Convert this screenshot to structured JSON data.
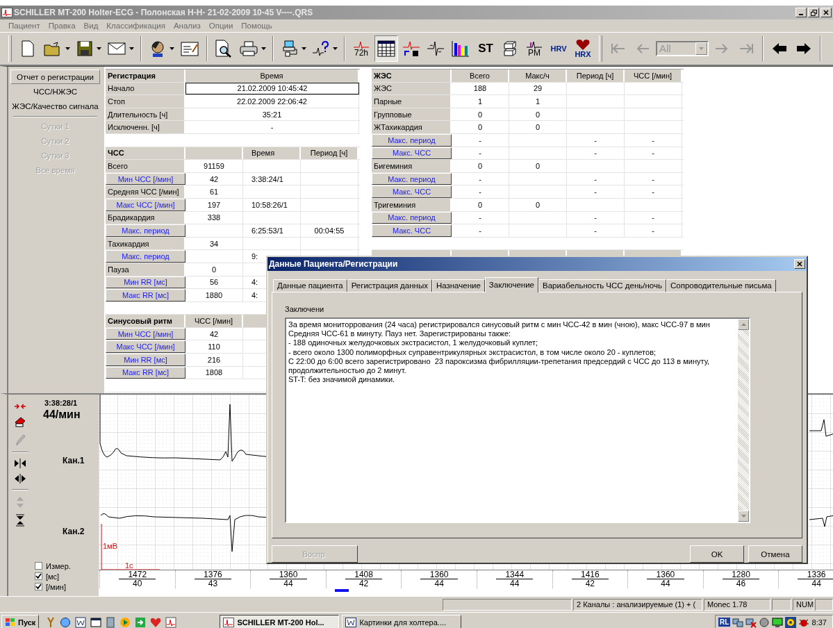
{
  "window": {
    "title": "SCHILLER MT-200 Holter-ECG - Полонская Н-Н- 21-02-2009 10-45 V----.QRS"
  },
  "menu": [
    "Пациент",
    "Правка",
    "Вид",
    "Классификация",
    "Анализ",
    "Опции",
    "Помощь"
  ],
  "toolbar": {
    "hours_label": "72h",
    "st_label": "ST",
    "pm_label": "PM",
    "hrv_label": "HRV",
    "hrx_label": "HRX",
    "table_selected": true,
    "filter": {
      "value": "All",
      "disabled": true
    }
  },
  "nav": [
    {
      "label": "Отчет о регистрации",
      "selected": true,
      "disabled": false
    },
    {
      "label": "ЧСС/НЖЭС",
      "selected": false,
      "disabled": false
    },
    {
      "label": "ЖЭС/Качество сигнала",
      "selected": false,
      "disabled": false
    },
    {
      "label": "Сутки 1",
      "selected": false,
      "disabled": true
    },
    {
      "label": "Сутки 2",
      "selected": false,
      "disabled": true
    },
    {
      "label": "Сутки 3",
      "selected": false,
      "disabled": true
    },
    {
      "label": "Все время",
      "selected": false,
      "disabled": true
    }
  ],
  "hr_table": {
    "rows": [
      {
        "kind": "wide_heading",
        "label": "Регистрация",
        "value": "Время"
      },
      {
        "kind": "wide",
        "label": "Начало",
        "value": "21.02.2009 10:45:42",
        "focused": true
      },
      {
        "kind": "wide",
        "label": "Стоп",
        "value": "22.02.2009 22:06:42",
        "focused": false
      },
      {
        "kind": "wide",
        "label": "Длительность [ч]",
        "value": "35:21",
        "focused": false
      },
      {
        "kind": "wide",
        "label": "Исключенн. [ч]",
        "value": "-",
        "focused": false
      },
      {
        "kind": "blank"
      },
      {
        "kind": "heading",
        "label": "ЧСС",
        "time": "Время",
        "period": "Период [ч]"
      },
      {
        "kind": "row",
        "label": "Всего",
        "value": "91159"
      },
      {
        "kind": "button_row",
        "label": "Мин ЧСС [/мин]",
        "value": "42",
        "time": "3:38:24/1"
      },
      {
        "kind": "row",
        "label": "Средняя ЧСС [/мин]",
        "value": "61"
      },
      {
        "kind": "button_row",
        "label": "Макс ЧСС [/мин]",
        "value": "197",
        "time": "10:58:26/1"
      },
      {
        "kind": "row",
        "label": "Брадикардия",
        "value": "338"
      },
      {
        "kind": "button_row",
        "label": "Макс. период",
        "time": "6:25:53/1",
        "period": "00:04:55"
      },
      {
        "kind": "row",
        "label": "Тахикардия",
        "value": "34"
      },
      {
        "kind": "button_row",
        "label": "Макс. период",
        "time": "9:"
      },
      {
        "kind": "row",
        "label": "Пауза",
        "value": "0"
      },
      {
        "kind": "button_row",
        "label": "Мин RR [мс]",
        "value": "56",
        "time": "4:"
      },
      {
        "kind": "button_row",
        "label": "Макс RR [мс]",
        "value": "1880",
        "time": "4:"
      },
      {
        "kind": "blank"
      },
      {
        "kind": "heading",
        "label": "Синусовый ритм",
        "value": "ЧСС [/мин]"
      },
      {
        "kind": "button_row",
        "label": "Мин ЧСС [/мин]",
        "value": "42"
      },
      {
        "kind": "button_row",
        "label": "Макс ЧСС [/мин]",
        "value": "110"
      },
      {
        "kind": "button_row",
        "label": "Мин RR [мс]",
        "value": "216"
      },
      {
        "kind": "button_row",
        "label": "Макс RR [мс]",
        "value": "1808"
      },
      {
        "kind": "blank"
      }
    ]
  },
  "pvc_table": {
    "rows": [
      {
        "kind": "heading",
        "label": "ЖЭС",
        "total": "Всего",
        "max_per_hour": "Макс/ч",
        "period": "Период [ч]",
        "hr": "ЧСС [/мин]"
      },
      {
        "kind": "row",
        "label": "ЖЭС",
        "total": "188",
        "max_per_hour": "29"
      },
      {
        "kind": "row",
        "label": "Парные",
        "total": "1",
        "max_per_hour": "1"
      },
      {
        "kind": "row",
        "label": "Групповые",
        "total": "0",
        "max_per_hour": "0"
      },
      {
        "kind": "row",
        "label": "ЖТахикардия",
        "total": "0",
        "max_per_hour": "0"
      },
      {
        "kind": "button_row",
        "label": "Макс. период",
        "total": "-",
        "period": "-",
        "hr": "-"
      },
      {
        "kind": "button_row",
        "label": "Макс. ЧСС",
        "total": "-",
        "period": "-",
        "hr": "-"
      },
      {
        "kind": "row",
        "label": "Бигеминия",
        "total": "0",
        "max_per_hour": "0"
      },
      {
        "kind": "button_row",
        "label": "Макс. период",
        "total": "-",
        "period": "-",
        "hr": "-"
      },
      {
        "kind": "button_row",
        "label": "Макс. ЧСС",
        "total": "-",
        "period": "-",
        "hr": "-"
      },
      {
        "kind": "row",
        "label": "Тригеминия",
        "total": "0",
        "max_per_hour": "0"
      },
      {
        "kind": "button_row",
        "label": "Макс. период",
        "total": "-",
        "period": "-",
        "hr": "-"
      },
      {
        "kind": "button_row",
        "label": "Макс. ЧСС",
        "total": "-",
        "period": "-",
        "hr": "-"
      },
      {
        "kind": "blank"
      },
      {
        "kind": "heading"
      }
    ]
  },
  "ecg": {
    "time": "3:38:28/1",
    "rate": "44/мин",
    "channels": [
      "Кан.1",
      "Кан.2"
    ],
    "scale_voltage": "1мВ",
    "scale_time": "1с",
    "options": [
      {
        "label": "Измер.",
        "checked": false
      },
      {
        "label": "[мс]",
        "checked": true
      },
      {
        "label": "[/мин]",
        "checked": true
      }
    ],
    "intervals": [
      {
        "rr": "1472",
        "rate": "40"
      },
      {
        "rr": "1376",
        "rate": "43"
      },
      {
        "rr": "1360",
        "rate": "44"
      },
      {
        "rr": "1408",
        "rate": "42"
      },
      {
        "rr": "1360",
        "rate": "44"
      },
      {
        "rr": "1344",
        "rate": "44"
      },
      {
        "rr": "1416",
        "rate": "42"
      },
      {
        "rr": "1360",
        "rate": "44"
      },
      {
        "rr": "1280",
        "rate": "46"
      },
      {
        "rr": "1336",
        "rate": "44"
      }
    ]
  },
  "dialog": {
    "title": "Данные Пациента/Регистрации",
    "tabs": [
      {
        "label": "Данные пациента",
        "selected": false
      },
      {
        "label": "Регистрация данных",
        "selected": false
      },
      {
        "label": "Назначение",
        "selected": false
      },
      {
        "label": "Заключение",
        "selected": true
      },
      {
        "label": "Вариабельность ЧСС день/ночь",
        "selected": false
      },
      {
        "label": "Сопроводительные письма",
        "selected": false
      }
    ],
    "field_label": "Заключени",
    "conclusion": "За время мониторрования (24 часа) регистрировался синусовый ритм с мин ЧСС-42 в мин (чною), макс ЧСС-97 в мин\nСредняя ЧСС-61 в минуту. Пауз нет. Зарегистрированы также:\n- 188 одиночных желудочковых экстрасистол, 1 желудочковый куплет;\n- всего около 1300 полиморфных суправентрикулярных экстрасистол, в том числе около 20 - куплетов;\nС 22:00 до 6:00 всего зарегистрировано  23 пароксизма фибрилляции-трепетания предсердий с ЧСС до 113 в минуту,\nпродолжительностью до 2 минут.\nST-T: без значимой динамики.",
    "buttons": [
      {
        "label": "Воспр.",
        "disabled": true
      },
      {
        "label": "OK",
        "disabled": false
      },
      {
        "label": "Отмена",
        "disabled": false
      }
    ]
  },
  "status_bar": {
    "channels": "2 Каналы : анализируемые (1) + (",
    "device": "Monec 1.78",
    "num": "NUM"
  },
  "taskbar": {
    "start": "Пуск",
    "tasks": [
      {
        "label": "SCHILLER MT-200 Hol...",
        "selected": true
      },
      {
        "label": "Картинки для холтера....",
        "selected": false
      }
    ],
    "language": "RL",
    "clock": "8:37"
  }
}
